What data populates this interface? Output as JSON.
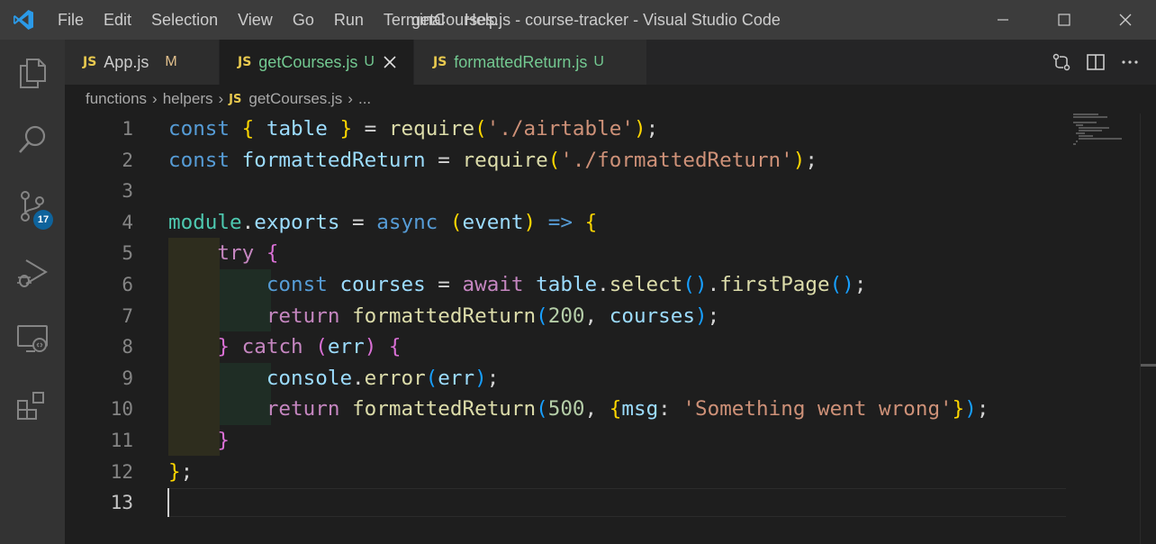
{
  "titlebar": {
    "menu": [
      "File",
      "Edit",
      "Selection",
      "View",
      "Go",
      "Run",
      "Terminal",
      "Help"
    ],
    "title": "getCourses.js - course-tracker - Visual Studio Code"
  },
  "activity": {
    "source_control_badge": "17"
  },
  "tabs": [
    {
      "icon": "JS",
      "name": "App.js",
      "status": "M",
      "name_color": "#cccccc",
      "status_color": "#e2c08d"
    },
    {
      "icon": "JS",
      "name": "getCourses.js",
      "status": "U",
      "name_color": "#73c991",
      "status_color": "#73c991"
    },
    {
      "icon": "JS",
      "name": "formattedReturn.js",
      "status": "U",
      "name_color": "#73c991",
      "status_color": "#73c991"
    }
  ],
  "breadcrumb": {
    "parts": [
      "functions",
      "helpers"
    ],
    "file_icon": "JS",
    "file": "getCourses.js",
    "more": "..."
  },
  "editor": {
    "line_numbers": [
      "1",
      "2",
      "3",
      "4",
      "5",
      "6",
      "7",
      "8",
      "9",
      "10",
      "11",
      "12",
      "13"
    ],
    "current_line": 13
  },
  "colors": {
    "accent": "#0e639c",
    "js_icon": "#e8c94f",
    "untracked": "#73c991",
    "modified": "#e2c08d"
  }
}
